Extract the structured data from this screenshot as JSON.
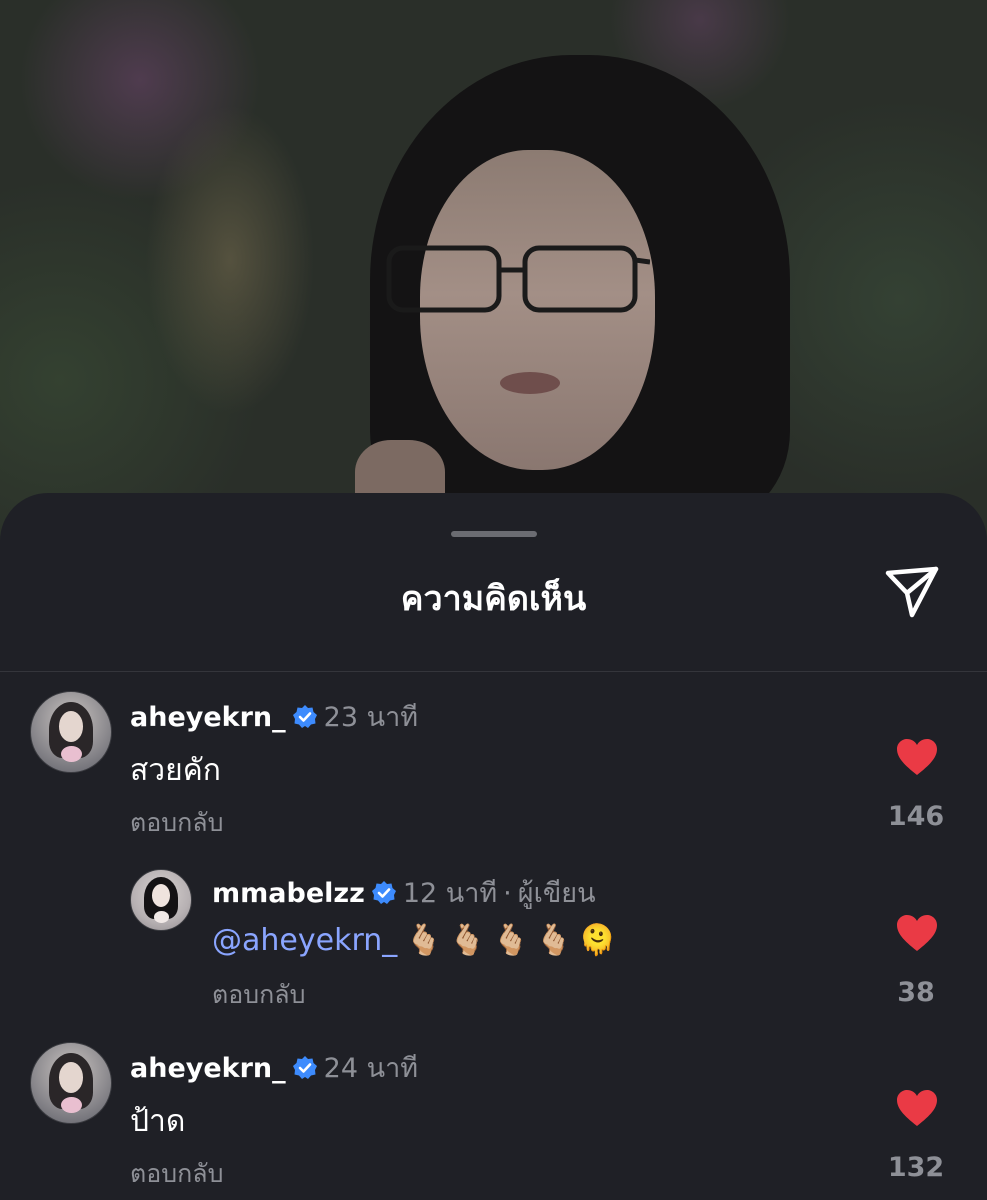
{
  "sheet": {
    "title": "ความคิดเห็น"
  },
  "colors": {
    "background": "#1f2026",
    "like": "#ea3a45",
    "verified": "#3d8bfd",
    "mention": "#8aa5ff",
    "muted": "#8e9097"
  },
  "icons": {
    "share": "send-icon",
    "like": "heart-icon",
    "verified": "verified-badge-icon"
  },
  "comments": [
    {
      "username": "aheyekrn_",
      "verified": true,
      "time": "23 นาที",
      "text": "สวยคัก",
      "reply_label": "ตอบกลับ",
      "likes": "146",
      "liked": true
    },
    {
      "username": "mmabelzz",
      "verified": true,
      "time": "12 นาที",
      "separator": "·",
      "author_tag": "ผู้เขียน",
      "mention": "@aheyekrn_",
      "emojis": "🫰🏼🫰🏼🫰🏼🫰🏼🫠",
      "reply_label": "ตอบกลับ",
      "likes": "38",
      "liked": true
    },
    {
      "username": "aheyekrn_",
      "verified": true,
      "time": "24 นาที",
      "text": "ป้าด",
      "reply_label": "ตอบกลับ",
      "likes": "132",
      "liked": true
    }
  ]
}
